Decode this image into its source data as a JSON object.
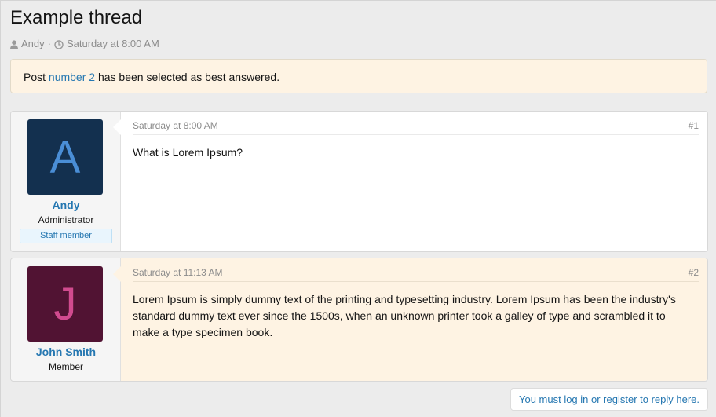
{
  "thread": {
    "title": "Example thread",
    "meta": {
      "author": "Andy",
      "separator": "·",
      "date": "Saturday at 8:00 AM",
      "author_icon": "user-icon",
      "date_icon": "clock-icon"
    }
  },
  "notice": {
    "prefix": "Post ",
    "link": "number 2",
    "suffix": " has been selected as best answered."
  },
  "posts": [
    {
      "number": "#1",
      "date": "Saturday at 8:00 AM",
      "body": "What is Lorem Ipsum?",
      "user": {
        "name": "Andy",
        "initial": "A",
        "title": "Administrator",
        "badge": "Staff member",
        "avatar_bg": "#13304f",
        "avatar_fg": "#4a8ed6"
      },
      "highlighted": false
    },
    {
      "number": "#2",
      "date": "Saturday at 11:13 AM",
      "body": "Lorem Ipsum is simply dummy text of the printing and typesetting industry. Lorem Ipsum has been the industry's standard dummy text ever since the 1500s, when an unknown printer took a galley of type and scrambled it to make a type specimen book.",
      "user": {
        "name": "John Smith",
        "initial": "J",
        "title": "Member",
        "avatar_bg": "#511333",
        "avatar_fg": "#d14b8f"
      },
      "highlighted": true
    }
  ],
  "reply": {
    "text": "You must log in or register to reply here."
  },
  "colors": {
    "link": "#2577b1",
    "highlight_bg": "#fef3e3",
    "page_bg": "#ececec"
  }
}
